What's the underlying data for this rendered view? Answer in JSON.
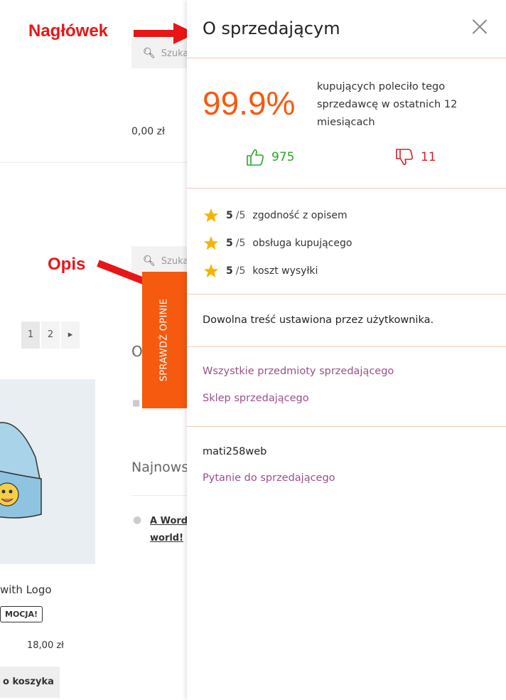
{
  "background": {
    "search_placeholder": "Szuka",
    "top_price": "0,00 zł",
    "pager": [
      "1",
      "2",
      "▸"
    ],
    "section_letter": "O",
    "newest_heading": "Najnows",
    "post_link": "A WordP world!",
    "product": {
      "name": "with Logo",
      "badge": "MOCJA!",
      "price": "18,00 zł",
      "cart_button": "o koszyka"
    }
  },
  "annotations": {
    "header_label": "Nagłówek",
    "description_label": "Opis",
    "color": "#e81616"
  },
  "review_tab": {
    "label": "SPRAWDŹ OPINIE",
    "color": "#f55a0f"
  },
  "panel": {
    "title": "O sprzedającym",
    "score": "99.9%",
    "recommend_text": "kupujących poleciło tego sprzedawcę w ostatnich 12 miesiącach",
    "positive_count": "975",
    "negative_count": "11",
    "ratings": [
      {
        "score": "5",
        "max": "/5",
        "label": "zgodność z opisem"
      },
      {
        "score": "5",
        "max": "/5",
        "label": "obsługa kupującego"
      },
      {
        "score": "5",
        "max": "/5",
        "label": "koszt wysyłki"
      }
    ],
    "description": "Dowolna treść ustawiona przez użytkownika.",
    "links": {
      "all_items": "Wszystkie przedmioty sprzedającego",
      "shop": "Sklep sprzedającego"
    },
    "username": "mati258web",
    "ask_seller": "Pytanie do sprzedającego",
    "colors": {
      "accent": "#f55a0f",
      "positive": "#2aa52a",
      "negative": "#d4202a",
      "link": "#9a4f8a"
    }
  }
}
